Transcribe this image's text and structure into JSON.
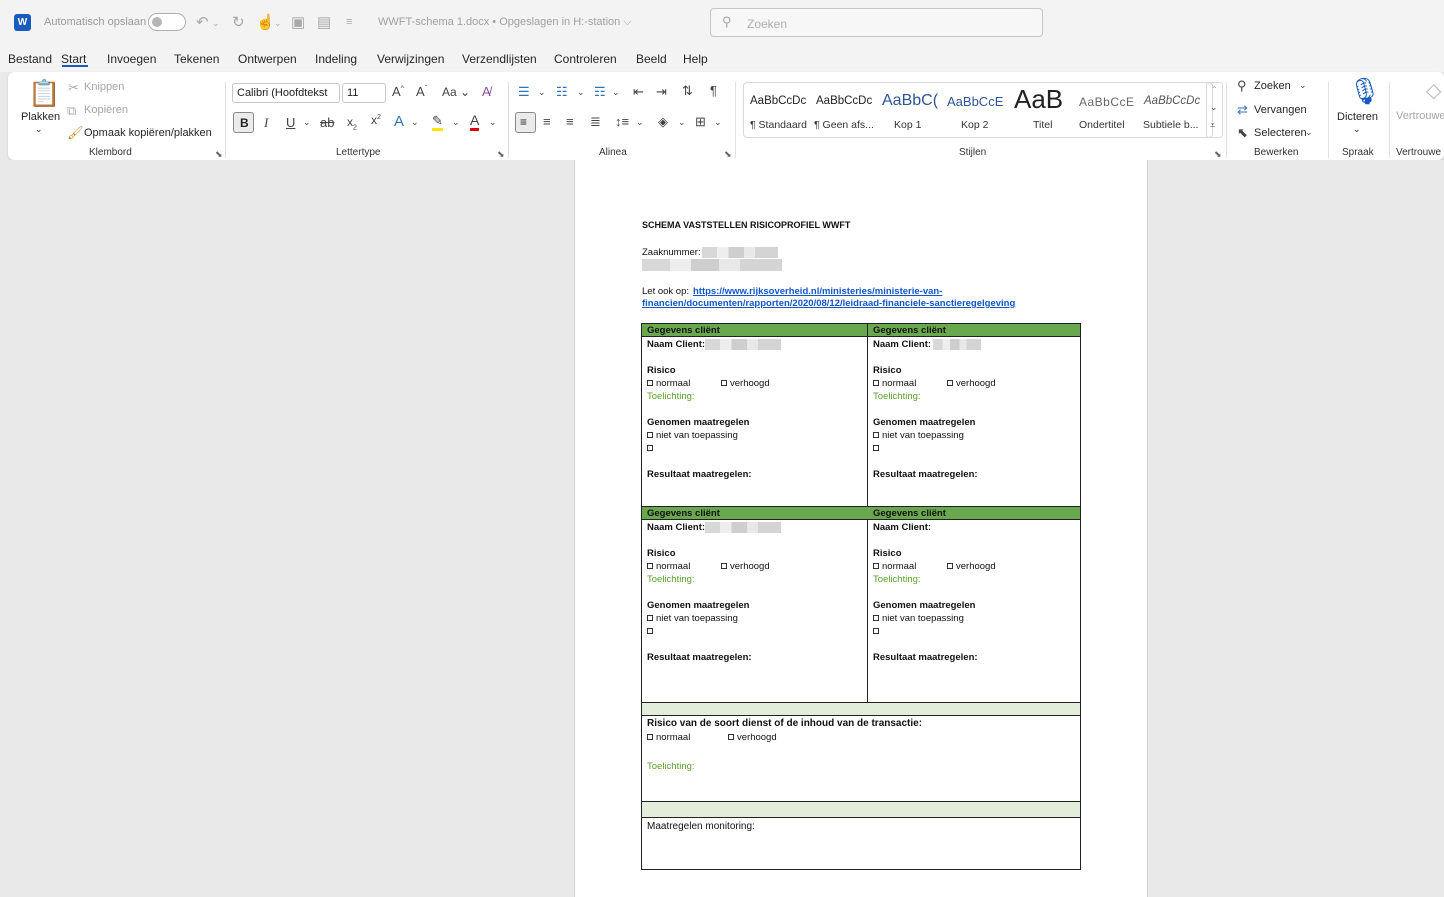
{
  "titlebar": {
    "app_letter": "W",
    "autosave_label": "Automatisch opslaan",
    "doc_title": "WWFT-schema 1.docx • Opgeslagen in H:-station ⌵",
    "search_placeholder": "Zoeken"
  },
  "menu": {
    "tabs": [
      "Bestand",
      "Start",
      "Invoegen",
      "Tekenen",
      "Ontwerpen",
      "Indeling",
      "Verwijzingen",
      "Verzendlijsten",
      "Controleren",
      "Beeld",
      "Help"
    ],
    "active": "Start"
  },
  "ribbon": {
    "klembord": {
      "paste": "Plakken",
      "cut": "Knippen",
      "copy": "Kopiëren",
      "format_painter": "Opmaak kopiëren/plakken",
      "label": "Klembord"
    },
    "lettertype": {
      "font_name": "Calibri (Hoofdtekst",
      "font_size": "11",
      "label": "Lettertype"
    },
    "alinea": {
      "label": "Alinea"
    },
    "stijlen": {
      "label": "Stijlen",
      "items": [
        {
          "preview": "AaBbCcDc",
          "name": "¶ Standaard"
        },
        {
          "preview": "AaBbCcDc",
          "name": "¶ Geen afs..."
        },
        {
          "preview": "AaBbC(",
          "name": "Kop 1"
        },
        {
          "preview": "AaBbCcE",
          "name": "Kop 2"
        },
        {
          "preview": "AaB",
          "name": "Titel"
        },
        {
          "preview": "AaBbCcE",
          "name": "Ondertitel"
        },
        {
          "preview": "AaBbCcDc",
          "name": "Subtiele b..."
        }
      ]
    },
    "bewerken": {
      "find": "Zoeken",
      "replace": "Vervangen",
      "select": "Selecteren",
      "label": "Bewerken"
    },
    "spraak": {
      "dictate": "Dicteren",
      "label": "Spraak"
    },
    "vertrouw": {
      "item": "Vertrouwe",
      "label": "Vertrouwe"
    }
  },
  "document": {
    "title": "SCHEMA VASTSTELLEN RISICOPROFIEL WWFT",
    "case_label": "Zaaknummer:",
    "see_also": "Let ook op: ",
    "link_line1": "https://www.rijksoverheid.nl/ministeries/ministerie-van-",
    "link_line2": "financien/documenten/rapporten/2020/08/12/leidraad-financiele-sanctieregelgeving",
    "client_header": "Gegevens cliënt",
    "client_name": "Naam Client:",
    "risk": "Risico",
    "normal": "normaal",
    "raised": "verhoogd",
    "explanation": "Toelichting:",
    "measures": "Genomen maatregelen",
    "not_applicable": "niet van toepassing",
    "result": "Resultaat maatregelen:",
    "service_risk": "Risico van de soort dienst of de inhoud van de transactie:",
    "monitoring": "Maatregelen monitoring:"
  },
  "colors": {
    "accent": "#185abd",
    "table_header": "#6aa84f",
    "light_green": "#e2eed9",
    "explanation_text": "#5aa02c"
  }
}
